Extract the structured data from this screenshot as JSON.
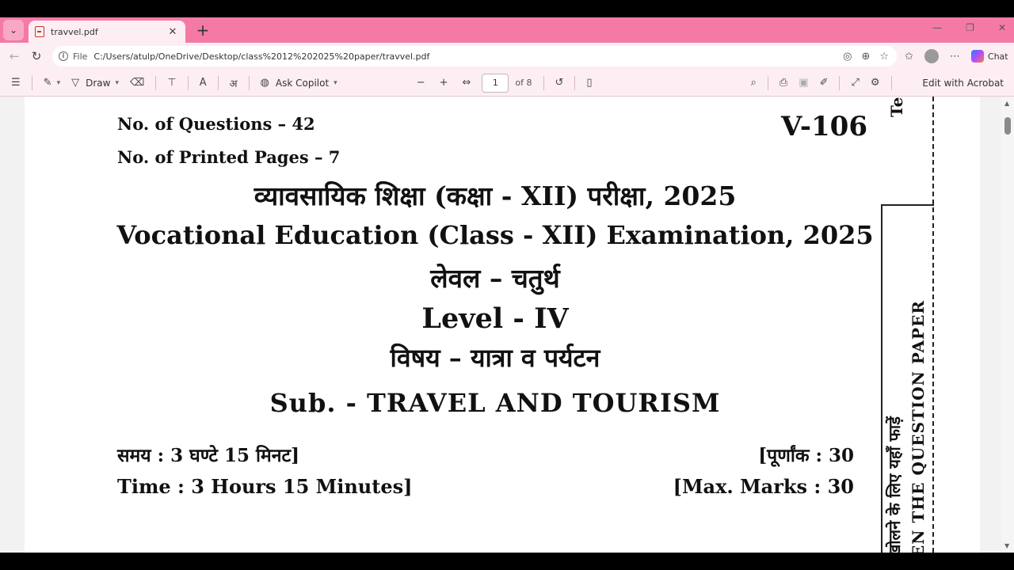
{
  "browser": {
    "tab_title": "travvel.pdf",
    "new_tab_symbol": "+",
    "file_label": "File",
    "url": "C:/Users/atulp/OneDrive/Desktop/class%2012%202025%20paper/travvel.pdf",
    "chat_label": "Chat",
    "theme_color": "#f47aa5"
  },
  "pdf_toolbar": {
    "draw_label": "Draw",
    "copilot_label": "Ask Copilot",
    "page_current": "1",
    "page_total_label": "of 8",
    "edit_acrobat_label": "Edit with Acrobat"
  },
  "page": {
    "questions": "No. of Questions – 42",
    "printed_pages": "No. of Printed Pages – 7",
    "code": "V-106",
    "hindi_title": "व्यावसायिक शिक्षा (कक्षा - XII) परीक्षा, 2025",
    "english_title": "Vocational Education (Class - XII) Examination, 2025",
    "hindi_level": "लेवल – चतुर्थ",
    "english_level": "Level - IV",
    "hindi_subject": "विषय – यात्रा व पर्यटन",
    "english_subject": "Sub. - TRAVEL AND TOURISM",
    "hindi_time": "समय : 3 घण्टे 15 मिनट]",
    "hindi_marks": "[पूर्णांक : 30",
    "english_time": "Time : 3 Hours 15 Minutes]",
    "english_marks": "[Max. Marks : 30",
    "side_hindi": "खोलने के लिए यहाँ फाड़ें",
    "side_english": "EN THE QUESTION PAPER",
    "side_top": "Te"
  }
}
